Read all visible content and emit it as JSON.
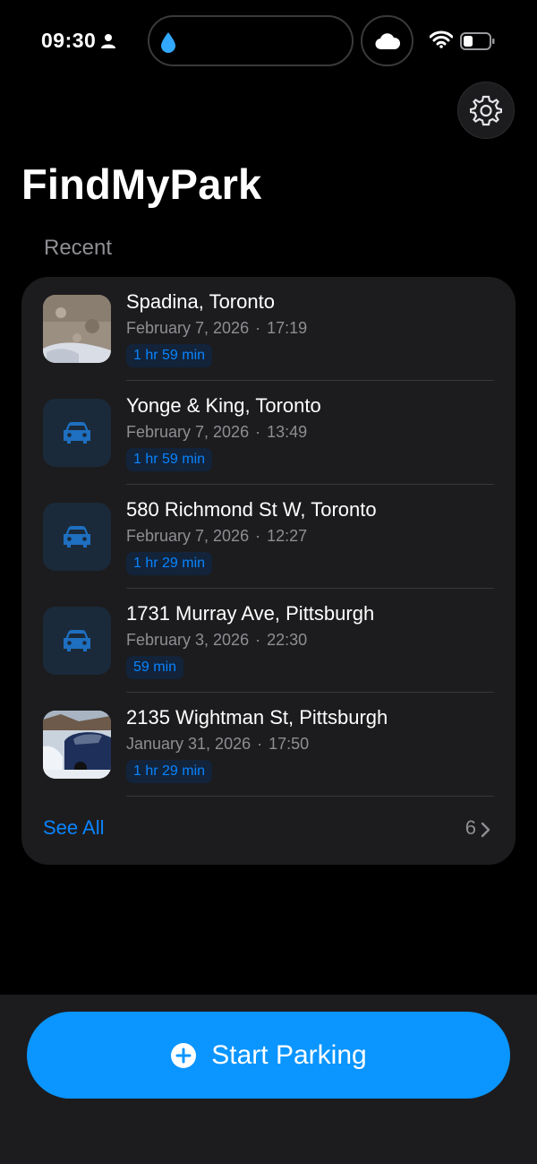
{
  "status": {
    "time": "09:30"
  },
  "app": {
    "title": "FindMyPark",
    "section": "Recent"
  },
  "parkings": [
    {
      "title": "Spadina, Toronto",
      "date": "February 7, 2026",
      "time": "17:19",
      "duration": "1 hr 59 min",
      "thumb": "photo-ground"
    },
    {
      "title": "Yonge & King, Toronto",
      "date": "February 7, 2026",
      "time": "13:49",
      "duration": "1 hr 59 min",
      "thumb": "car-icon"
    },
    {
      "title": "580 Richmond St W, Toronto",
      "date": "February 7, 2026",
      "time": "12:27",
      "duration": "1 hr 29 min",
      "thumb": "car-icon"
    },
    {
      "title": "1731 Murray Ave, Pittsburgh",
      "date": "February 3, 2026",
      "time": "22:30",
      "duration": "59 min",
      "thumb": "car-icon"
    },
    {
      "title": "2135 Wightman St, Pittsburgh",
      "date": "January 31, 2026",
      "time": "17:50",
      "duration": "1 hr 29 min",
      "thumb": "photo-car-snow"
    }
  ],
  "footer": {
    "see_all": "See All",
    "count": "6"
  },
  "actions": {
    "start_parking": "Start Parking"
  },
  "colors": {
    "accent": "#0a84ff",
    "button": "#0a95ff",
    "card": "#1c1c1e"
  }
}
